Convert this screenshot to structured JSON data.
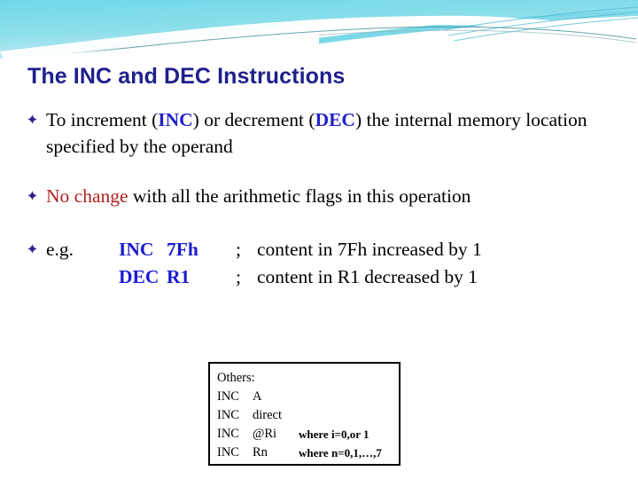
{
  "slide": {
    "title": "The INC and DEC Instructions",
    "title_color": "#1f1f8c",
    "background_color": "#ffffff",
    "banner": {
      "gradient_from": "#5ed7e6",
      "gradient_to": "#a7e4ef",
      "accent_color": "#2e9fc0",
      "icon": "decorative-wave-banner"
    },
    "bullet_icon": "diamond-bullet-icon",
    "bullet_color": "#3a1f8f"
  },
  "bullets": [
    {
      "id": "bullet-1",
      "segments": [
        {
          "text": "To increment (",
          "style": "plain"
        },
        {
          "text": "INC",
          "style": "blue"
        },
        {
          "text": ") or decrement (",
          "style": "plain"
        },
        {
          "text": "DEC",
          "style": "blue"
        },
        {
          "text": ") the internal memory location specified by the operand",
          "style": "plain"
        }
      ]
    },
    {
      "id": "bullet-2",
      "segments": [
        {
          "text": "No change",
          "style": "red"
        },
        {
          "text": " with all the arithmetic flags in this operation",
          "style": "plain"
        }
      ]
    }
  ],
  "example": {
    "label": "e.g.",
    "lines": [
      {
        "mnemonic": "INC",
        "operand": "7Fh",
        "separator": ";",
        "comment": "content in 7Fh increased by 1"
      },
      {
        "mnemonic": "DEC",
        "operand": "R1",
        "separator": ";",
        "comment": "content in R1 decreased by 1"
      }
    ]
  },
  "others_box": {
    "heading": "Others:",
    "rows": [
      {
        "mnemonic": "INC",
        "operand": "A",
        "note": ""
      },
      {
        "mnemonic": "INC",
        "operand": "direct",
        "note": ""
      },
      {
        "mnemonic": "INC",
        "operand": "@Ri",
        "note": "where i=0,or 1"
      },
      {
        "mnemonic": "INC",
        "operand": "Rn",
        "note": "where n=0,1,…,7"
      }
    ]
  }
}
